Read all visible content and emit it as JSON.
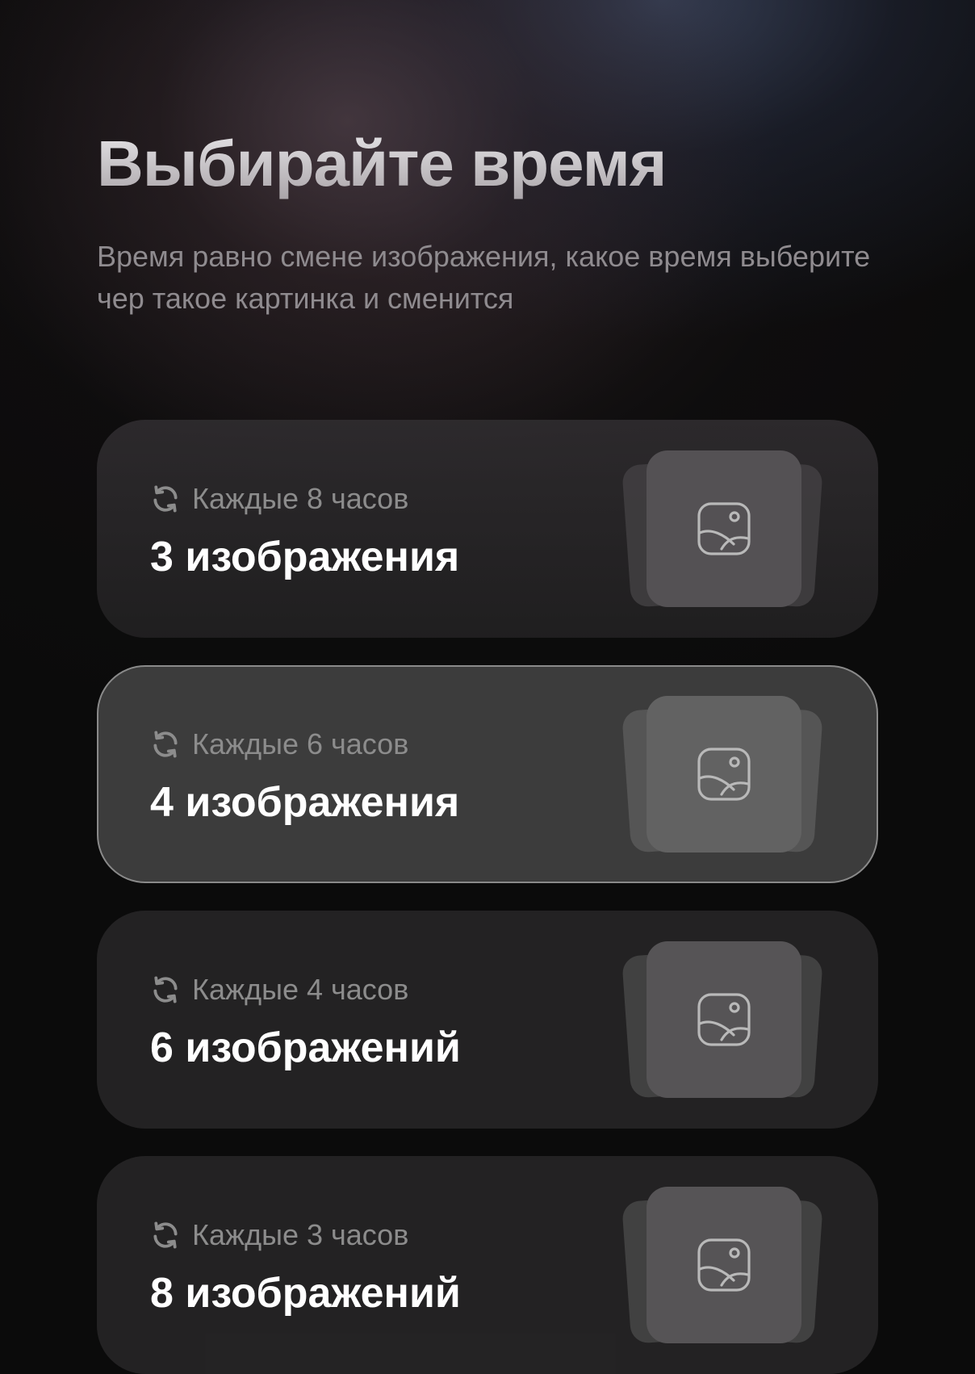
{
  "header": {
    "title": "Выбирайте время",
    "subtitle": "Время равно смене изображения, какое время выберите чер такое картинка и сменится"
  },
  "options": [
    {
      "frequency": "Каждые 8 часов",
      "count": "3 изображения",
      "selected": false
    },
    {
      "frequency": "Каждые 6 часов",
      "count": "4 изображения",
      "selected": true
    },
    {
      "frequency": "Каждые 4 часов",
      "count": "6 изображений",
      "selected": false
    },
    {
      "frequency": "Каждые 3 часов",
      "count": "8 изображений",
      "selected": false
    }
  ],
  "icons": {
    "frequency": "refresh-icon",
    "preview": "image-icon"
  },
  "colors": {
    "background": "#0b0b0b",
    "card": "#262526",
    "card_selected": "#3c3c3c",
    "card_selected_border": "#8a8a8a",
    "text_primary": "#ffffff",
    "text_secondary": "#8c8c8c"
  }
}
